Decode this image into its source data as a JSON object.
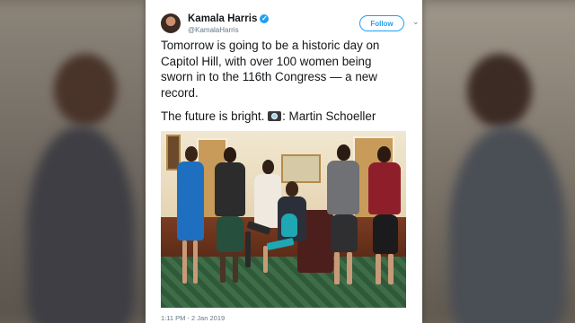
{
  "tweet": {
    "author_name": "Kamala Harris",
    "author_handle": "@KamalaHarris",
    "follow_label": "Follow",
    "text_lines": [
      "Tomorrow is going to be a historic day on",
      "Capitol Hill, with over 100 women being",
      "sworn in to the 116th Congress — a new",
      "record."
    ],
    "credit_prefix": "The future is bright.",
    "credit_suffix": ": Martin Schoeller",
    "timestamp": "1:11 PM - 2 Jan 2019"
  },
  "icons": {
    "verified": "verified-badge-icon",
    "caret": "chevron-down-icon",
    "camera": "camera-icon"
  },
  "colors": {
    "accent": "#1da1f2",
    "text": "#14171a",
    "secondary": "#657786"
  }
}
